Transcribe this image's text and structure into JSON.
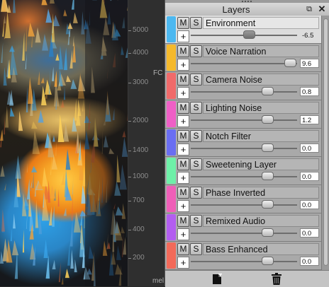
{
  "axis": {
    "ticks": [
      "5000",
      "4000",
      "3000",
      "2000",
      "1400",
      "1000",
      "700",
      "400",
      "200"
    ],
    "fragments": [
      "FC",
      "mel"
    ]
  },
  "panel": {
    "title": "Layers",
    "float_icon": "float-window-icon",
    "close_icon": "close-icon",
    "mute_label": "M",
    "solo_label": "S",
    "add_label": "+",
    "layers": [
      {
        "name": "Environment",
        "value": "-6.5",
        "color": "#4cb8f0",
        "level": 0.55,
        "selected": true
      },
      {
        "name": "Voice Narration",
        "value": "9.6",
        "color": "#f5b92c",
        "level": 0.98,
        "selected": false
      },
      {
        "name": "Camera Noise",
        "value": "0.8",
        "color": "#f06a6a",
        "level": 0.74,
        "selected": false
      },
      {
        "name": "Lighting Noise",
        "value": "1.2",
        "color": "#ef5fc6",
        "level": 0.74,
        "selected": false
      },
      {
        "name": "Notch Filter",
        "value": "0.0",
        "color": "#6a6ef2",
        "level": 0.74,
        "selected": false
      },
      {
        "name": "Sweetening Layer",
        "value": "0.0",
        "color": "#6ef0a8",
        "level": 0.74,
        "selected": false
      },
      {
        "name": "Phase Inverted",
        "value": "0.0",
        "color": "#ef5fb8",
        "level": 0.74,
        "selected": false
      },
      {
        "name": "Remixed Audio",
        "value": "0.0",
        "color": "#b35ef0",
        "level": 0.74,
        "selected": false
      },
      {
        "name": "Bass Enhanced",
        "value": "0.0",
        "color": "#f26a5a",
        "level": 0.74,
        "selected": false
      }
    ],
    "footer": {
      "add_icon": "add-layer-icon",
      "delete_icon": "trash-icon"
    }
  }
}
